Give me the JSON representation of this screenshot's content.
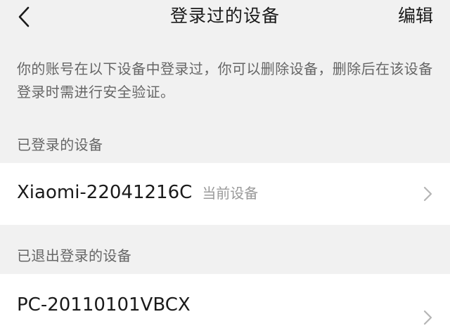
{
  "nav": {
    "title": "登录过的设备",
    "edit_label": "编辑",
    "back_icon": "chevron-left-icon"
  },
  "notice": "你的账号在以下设备中登录过，你可以删除设备，删除后在该设备登录时需进行安全验证。",
  "logged_in": {
    "header": "已登录的设备",
    "devices": [
      {
        "name": "Xiaomi-22041216C",
        "tag": "当前设备"
      }
    ]
  },
  "logged_out": {
    "header": "已退出登录的设备",
    "devices": [
      {
        "name": "PC-20110101VBCX"
      }
    ]
  },
  "colors": {
    "page_bg": "#f1f1f1",
    "card_bg": "#ffffff",
    "secondary_text": "#666666",
    "tag_text": "#9a9a9a",
    "chevron": "#b5b5b5"
  }
}
